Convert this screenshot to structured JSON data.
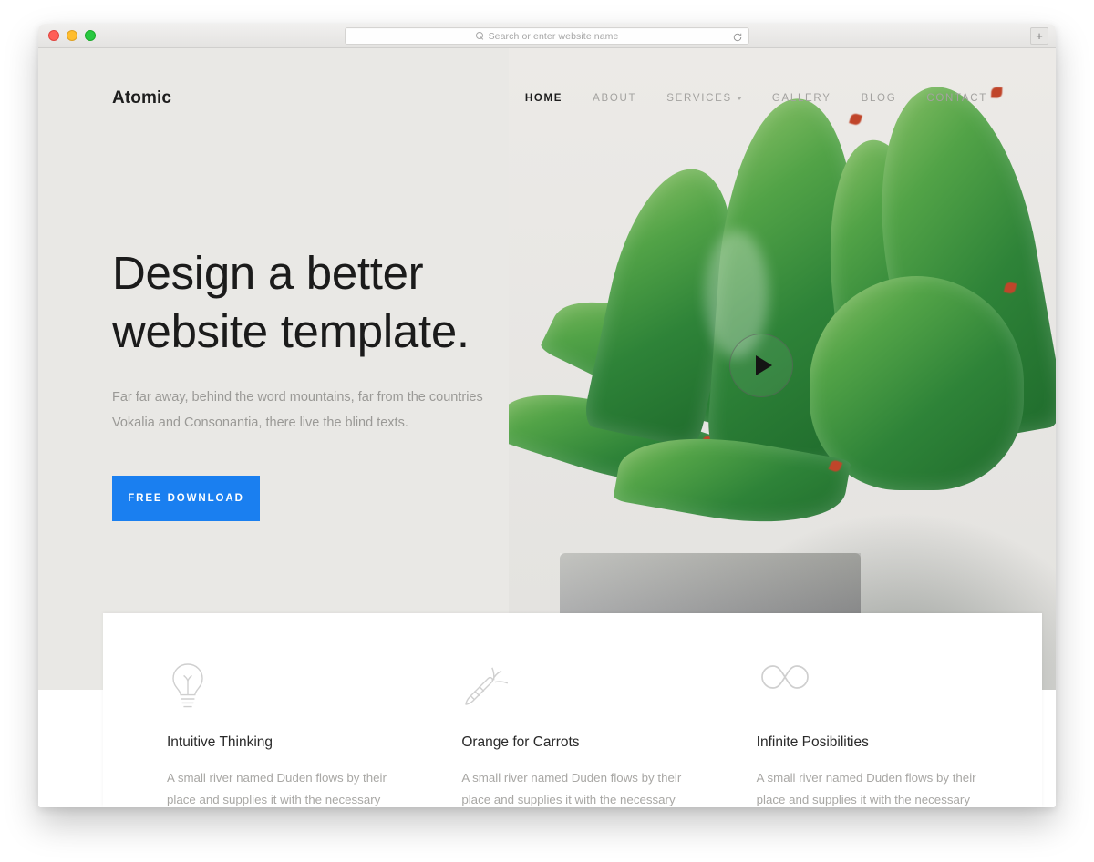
{
  "browser": {
    "traffic_lights": [
      "close",
      "minimize",
      "maximize"
    ],
    "address_placeholder": "Search or enter website name",
    "search_icon": "search-icon",
    "reload_icon": "reload-icon",
    "new_tab_label": "+"
  },
  "site": {
    "logo": "Atomic",
    "nav": [
      {
        "label": "HOME",
        "active": true,
        "dropdown": false
      },
      {
        "label": "ABOUT",
        "active": false,
        "dropdown": false
      },
      {
        "label": "SERVICES",
        "active": false,
        "dropdown": true
      },
      {
        "label": "GALLERY",
        "active": false,
        "dropdown": false
      },
      {
        "label": "BLOG",
        "active": false,
        "dropdown": false
      },
      {
        "label": "CONTACT",
        "active": false,
        "dropdown": false
      }
    ]
  },
  "hero": {
    "headline_line1": "Design a better",
    "headline_line2": "website template.",
    "subhead": "Far far away, behind the word mountains, far from the countries Vokalia and Consonantia, there live the blind texts.",
    "cta_label": "FREE DOWNLOAD",
    "play_button": "play-icon",
    "image_alt": "green succulent plant in gray concrete pot"
  },
  "features": [
    {
      "icon": "lightbulb-icon",
      "title": "Intuitive Thinking",
      "body": "A small river named Duden flows by their place and supplies it with the necessary regelialia."
    },
    {
      "icon": "carrot-icon",
      "title": "Orange for Carrots",
      "body": "A small river named Duden flows by their place and supplies it with the necessary regelialia."
    },
    {
      "icon": "infinity-icon",
      "title": "Infinite Posibilities",
      "body": "A small river named Duden flows by their place and supplies it with the necessary regelialia."
    }
  ],
  "colors": {
    "accent_blue": "#1a7ff0",
    "hero_bg": "#e9e8e5",
    "heading": "#1b1b1b",
    "muted_text": "#a8a7a4",
    "icon_gray": "#cfcfcf"
  }
}
